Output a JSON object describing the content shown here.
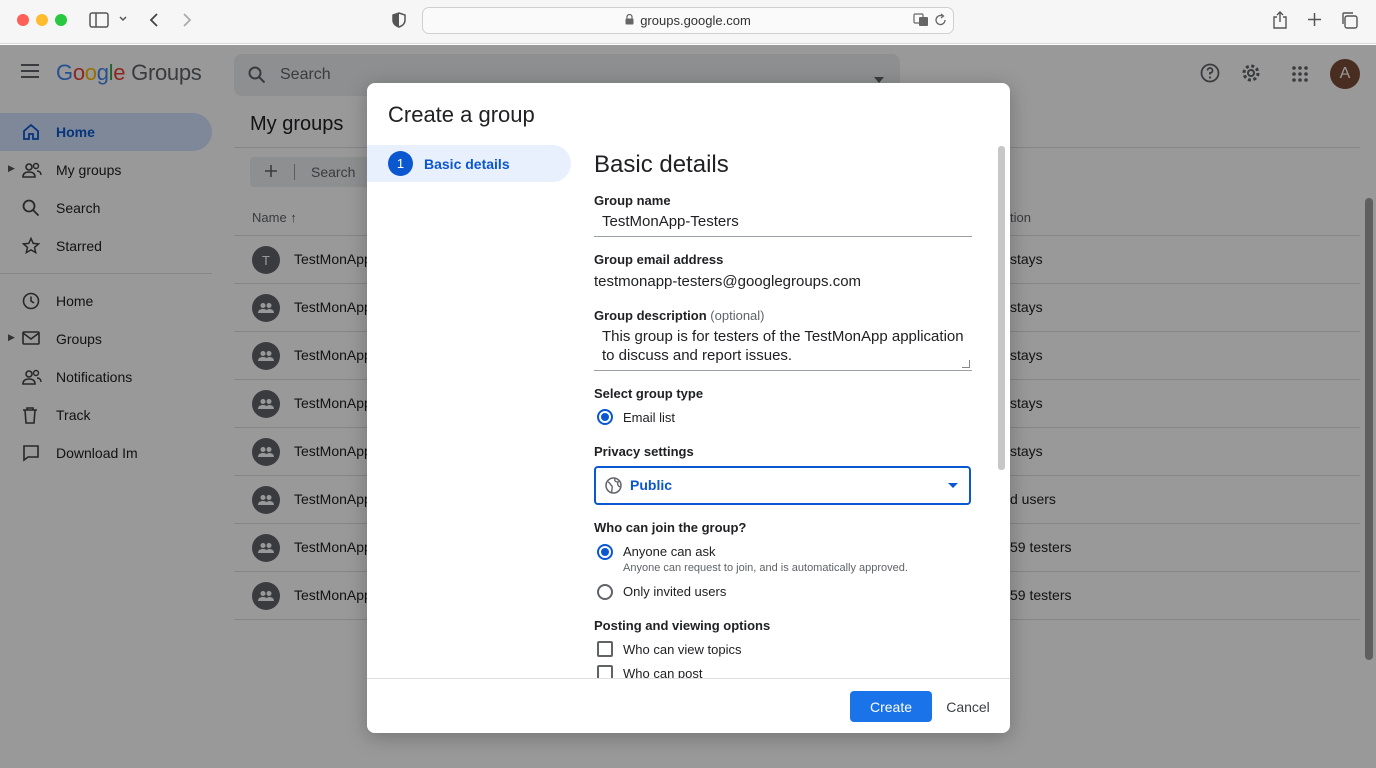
{
  "browser": {
    "url": "groups.google.com"
  },
  "header": {
    "brand_google": [
      "G",
      "o",
      "o",
      "g",
      "l",
      "e"
    ],
    "brand_groups": "Groups",
    "search_placeholder": "Search",
    "avatar_initial": "A"
  },
  "sidebar": {
    "items": [
      {
        "label": "Home",
        "icon": "home-icon",
        "active": true
      },
      {
        "label": "My groups",
        "icon": "people-icon",
        "expandable": true
      },
      {
        "label": "Search",
        "icon": "search-icon"
      },
      {
        "label": "Starred",
        "icon": "star-icon"
      },
      {
        "label": "Home",
        "icon": "clock-icon"
      },
      {
        "label": "Groups",
        "icon": "mail-icon",
        "expandable": true
      },
      {
        "label": "Notifications",
        "icon": "people-icon"
      },
      {
        "label": "Track",
        "icon": "trash-icon"
      },
      {
        "label": "Download Im",
        "icon": "chat-icon"
      }
    ]
  },
  "main": {
    "title": "My groups",
    "toolbar_search": "Search",
    "col_name": "Name ↑",
    "col_right": "tion",
    "rows": [
      {
        "avatar": "T",
        "name": "TestMonApp",
        "tail": "stays"
      },
      {
        "avatar": "",
        "name": "TestMonApp",
        "tail": "stays"
      },
      {
        "avatar": "",
        "name": "TestMonApp",
        "tail": "stays"
      },
      {
        "avatar": "",
        "name": "TestMonApp",
        "tail": "stays"
      },
      {
        "avatar": "",
        "name": "TestMonApp",
        "tail": "stays"
      },
      {
        "avatar": "",
        "name": "TestMonApp",
        "tail": "d users"
      },
      {
        "avatar": "",
        "name": "TestMonApp",
        "tail": "59 testers"
      },
      {
        "avatar": "",
        "name": "TestMonApp",
        "tail": "59 testers"
      }
    ]
  },
  "dialog": {
    "title": "Create a group",
    "step_number": "1",
    "step_label": "Basic details",
    "section_title": "Basic details",
    "group_name_label": "Group name",
    "group_name_value": "TestMonApp-Testers",
    "email_label": "Group email address",
    "email_value": "testmonapp-testers@googlegroups.com",
    "description_label": "Group description",
    "description_optional": "(optional)",
    "description_value": "This group is for testers of the TestMonApp application to discuss and report issues.",
    "group_type_label": "Select group type",
    "group_type_option": "Email list",
    "privacy_label": "Privacy settings",
    "privacy_value": "Public",
    "join_label": "Who can join the group?",
    "join_option1": "Anyone can ask",
    "join_option1_help": "Anyone can request to join, and is automatically approved.",
    "join_option2": "Only invited users",
    "posting_label": "Posting and viewing options",
    "posting_option1": "Who can view topics",
    "posting_option2": "Who can post",
    "create_label": "Create",
    "cancel_label": "Cancel"
  },
  "colors": {
    "accent": "#0b57d0",
    "create_button": "#1a73e8"
  }
}
